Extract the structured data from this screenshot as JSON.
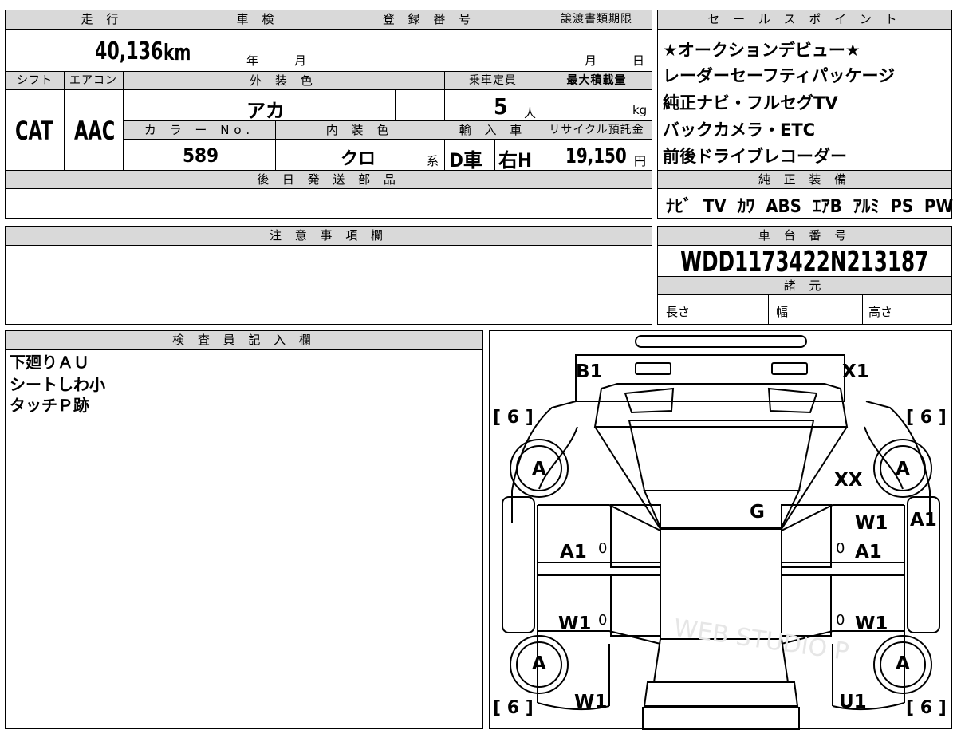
{
  "vehicle": {
    "mileage_label": "走 行",
    "mileage": "40,136",
    "mileage_unit": "km",
    "inspection_label": "車 検",
    "inspection_year_unit": "年",
    "inspection_month_unit": "月",
    "reg_no_label": "登 録 番 号",
    "transfer_label": "譲渡書類期限",
    "transfer_month_unit": "月",
    "transfer_day_unit": "日",
    "shift_label": "シフト",
    "shift": "CAT",
    "ac_label": "エアコン",
    "ac": "AAC",
    "ext_color_label": "外 装 色",
    "ext_color": "アカ",
    "capacity_label": "乗車定員",
    "capacity": "5",
    "capacity_unit": "人",
    "max_load_label": "最大積載量",
    "max_load_unit": "kg",
    "color_no_label": "カ ラ ー No.",
    "color_no": "589",
    "int_color_label": "内 装 色",
    "int_color": "クロ",
    "int_color_unit": "系",
    "import_label": "輸 入 車",
    "import_type": "D車",
    "handle": "右H",
    "recycle_label": "リサイクル預託金",
    "recycle_fee": "19,150",
    "recycle_unit": "円",
    "later_parts_label": "後 日 発 送 部 品"
  },
  "sales_points": {
    "label": "セ ー ル ス ポ イ ン ト",
    "items": [
      "★オークションデビュー★",
      "レーダーセーフティパッケージ",
      "純正ナビ・フルセグTV",
      "バックカメラ・ETC",
      "前後ドライブレコーダー"
    ]
  },
  "equipment": {
    "label": "純 正 装 備",
    "items": [
      "ﾅﾋﾞ",
      "TV",
      "ｶﾜ",
      "ABS",
      "ｴｱB",
      "ｱﾙﾐ",
      "PS",
      "PW"
    ]
  },
  "notes_label": "注 意 事 項 欄",
  "chassis": {
    "label": "車 台 番 号",
    "number": "WDD1173422N213187",
    "specs_label": "諸 元",
    "length_label": "長さ",
    "width_label": "幅",
    "height_label": "高さ"
  },
  "inspector": {
    "label": "検 査 員 記 入 欄",
    "lines": [
      "下廻りＡＵ",
      "シートしわ小",
      "タッチＰ跡"
    ]
  },
  "diagram": {
    "marks": {
      "b1": "B1",
      "x1": "X1",
      "xx": "XX",
      "g": "G",
      "w1_top_right": "W1",
      "a1_right_edge": "A1",
      "a1_left": "A1",
      "a1_right": "A1",
      "w1_left": "W1",
      "w1_right": "W1",
      "w1_bottom_left": "W1",
      "u1_bottom_right": "U1"
    },
    "tire_grade": "A",
    "tire_tread": "6",
    "zero": "0",
    "watermark": "WEB STUDIO P"
  }
}
